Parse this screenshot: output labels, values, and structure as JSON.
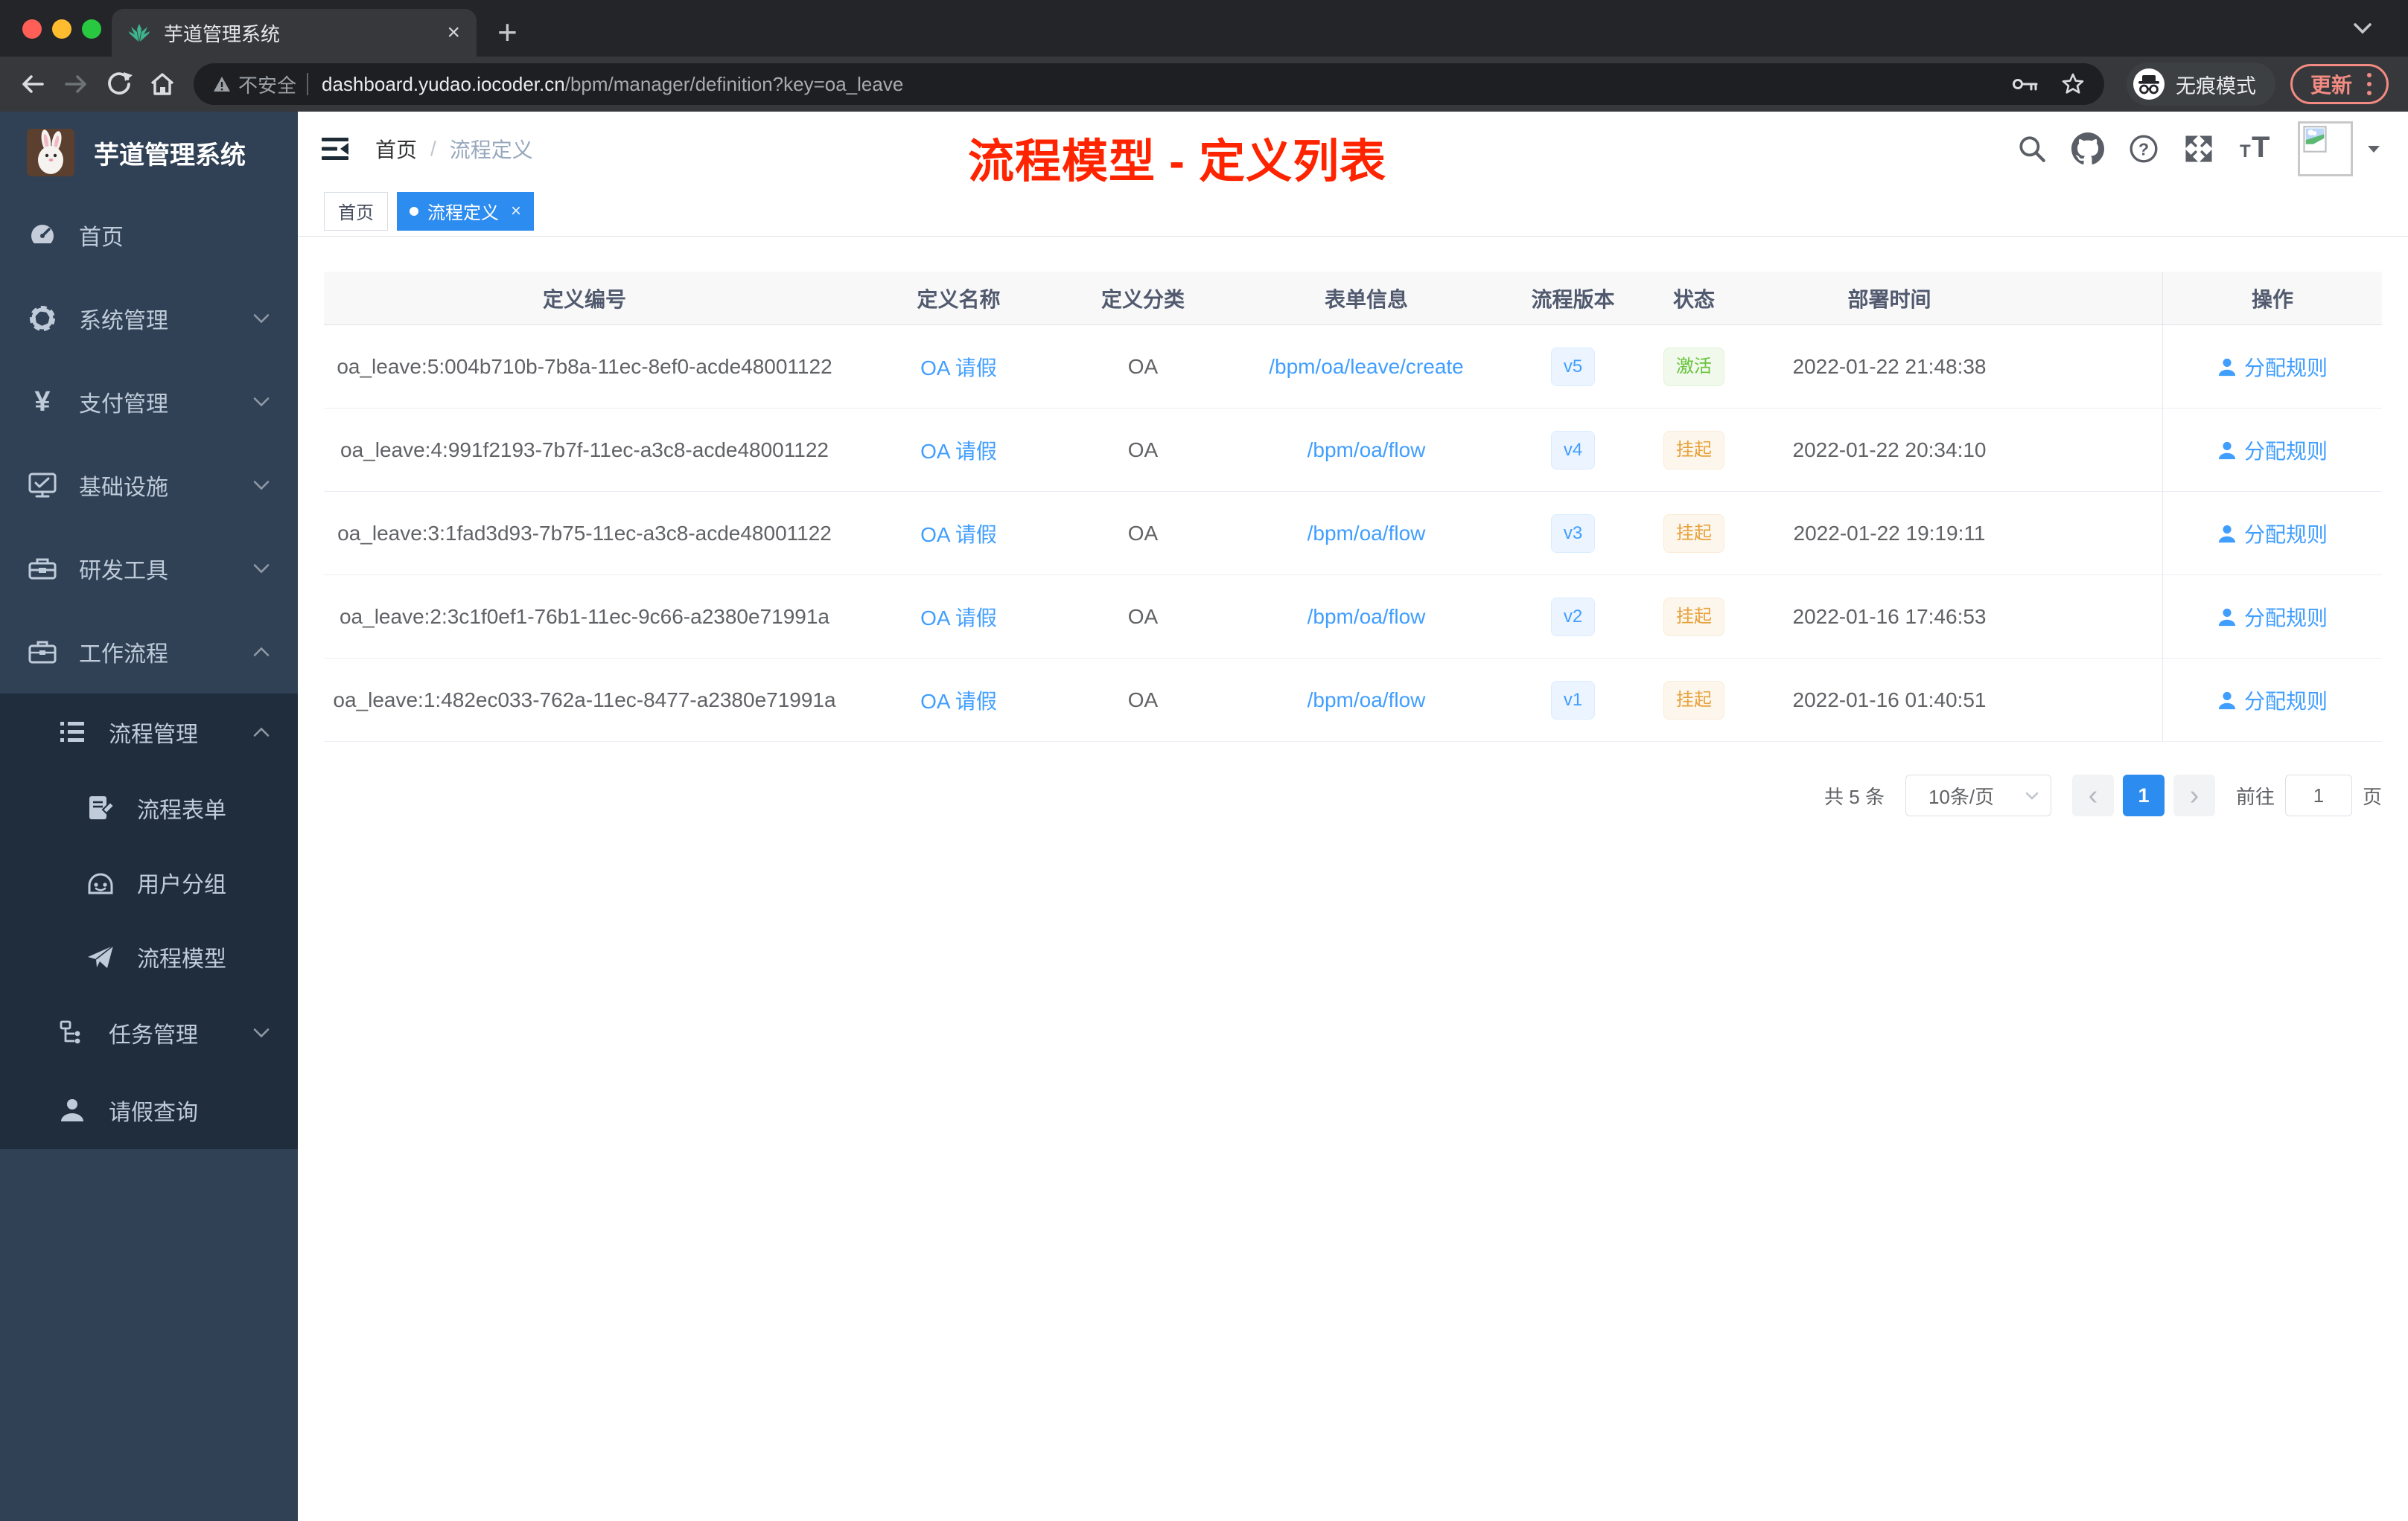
{
  "browser": {
    "tab_title": "芋道管理系统",
    "security_label": "不安全",
    "url_domain": "dashboard.yudao.iocoder.cn",
    "url_path": "/bpm/manager/definition?key=oa_leave",
    "incognito_label": "无痕模式",
    "update_label": "更新"
  },
  "icons": {
    "close": "×",
    "plus": "+",
    "question": "?",
    "prev": "‹",
    "next": "›",
    "yen": "¥",
    "font_small": "T",
    "font_big": "T"
  },
  "sidebar": {
    "logo_title": "芋道管理系统",
    "items": [
      {
        "label": "首页"
      },
      {
        "label": "系统管理"
      },
      {
        "label": "支付管理"
      },
      {
        "label": "基础设施"
      },
      {
        "label": "研发工具"
      },
      {
        "label": "工作流程"
      }
    ],
    "submenu": {
      "manage": {
        "label": "流程管理"
      },
      "children": [
        {
          "label": "流程表单"
        },
        {
          "label": "用户分组"
        },
        {
          "label": "流程模型"
        }
      ],
      "tasks": {
        "label": "任务管理"
      },
      "leave": {
        "label": "请假查询"
      }
    }
  },
  "header": {
    "breadcrumb_home": "首页",
    "breadcrumb_sep": "/",
    "breadcrumb_current": "流程定义",
    "annotation": "流程模型 - 定义列表"
  },
  "tags": {
    "home": "首页",
    "active": "流程定义"
  },
  "table": {
    "columns": [
      "定义编号",
      "定义名称",
      "定义分类",
      "表单信息",
      "流程版本",
      "状态",
      "部署时间",
      "操作"
    ],
    "rows": [
      {
        "id": "oa_leave:5:004b710b-7b8a-11ec-8ef0-acde48001122",
        "name": "OA 请假",
        "category": "OA",
        "form": "/bpm/oa/leave/create",
        "version": "v5",
        "status": "激活",
        "time": "2022-01-22 21:48:38",
        "action": "分配规则"
      },
      {
        "id": "oa_leave:4:991f2193-7b7f-11ec-a3c8-acde48001122",
        "name": "OA 请假",
        "category": "OA",
        "form": "/bpm/oa/flow",
        "version": "v4",
        "status": "挂起",
        "time": "2022-01-22 20:34:10",
        "action": "分配规则"
      },
      {
        "id": "oa_leave:3:1fad3d93-7b75-11ec-a3c8-acde48001122",
        "name": "OA 请假",
        "category": "OA",
        "form": "/bpm/oa/flow",
        "version": "v3",
        "status": "挂起",
        "time": "2022-01-22 19:19:11",
        "action": "分配规则"
      },
      {
        "id": "oa_leave:2:3c1f0ef1-76b1-11ec-9c66-a2380e71991a",
        "name": "OA 请假",
        "category": "OA",
        "form": "/bpm/oa/flow",
        "version": "v2",
        "status": "挂起",
        "time": "2022-01-16 17:46:53",
        "action": "分配规则"
      },
      {
        "id": "oa_leave:1:482ec033-762a-11ec-8477-a2380e71991a",
        "name": "OA 请假",
        "category": "OA",
        "form": "/bpm/oa/flow",
        "version": "v1",
        "status": "挂起",
        "time": "2022-01-16 01:40:51",
        "action": "分配规则"
      }
    ]
  },
  "pagination": {
    "total": "共 5 条",
    "page_size": "10条/页",
    "current": "1",
    "goto_label": "前往",
    "goto_value": "1",
    "unit": "页"
  },
  "colors": {
    "accent_blue": "#409eff",
    "tag_active_blue": "#2d8cf0",
    "success_green": "#67c23a",
    "warning_orange": "#e6a23c",
    "sidebar_bg": "#304156",
    "submenu_bg": "#1f2d3d",
    "annotation_red": "#ff2400",
    "chrome_dark": "#242528",
    "chrome_toolbar": "#37383c",
    "update_salmon": "#f28b82"
  }
}
